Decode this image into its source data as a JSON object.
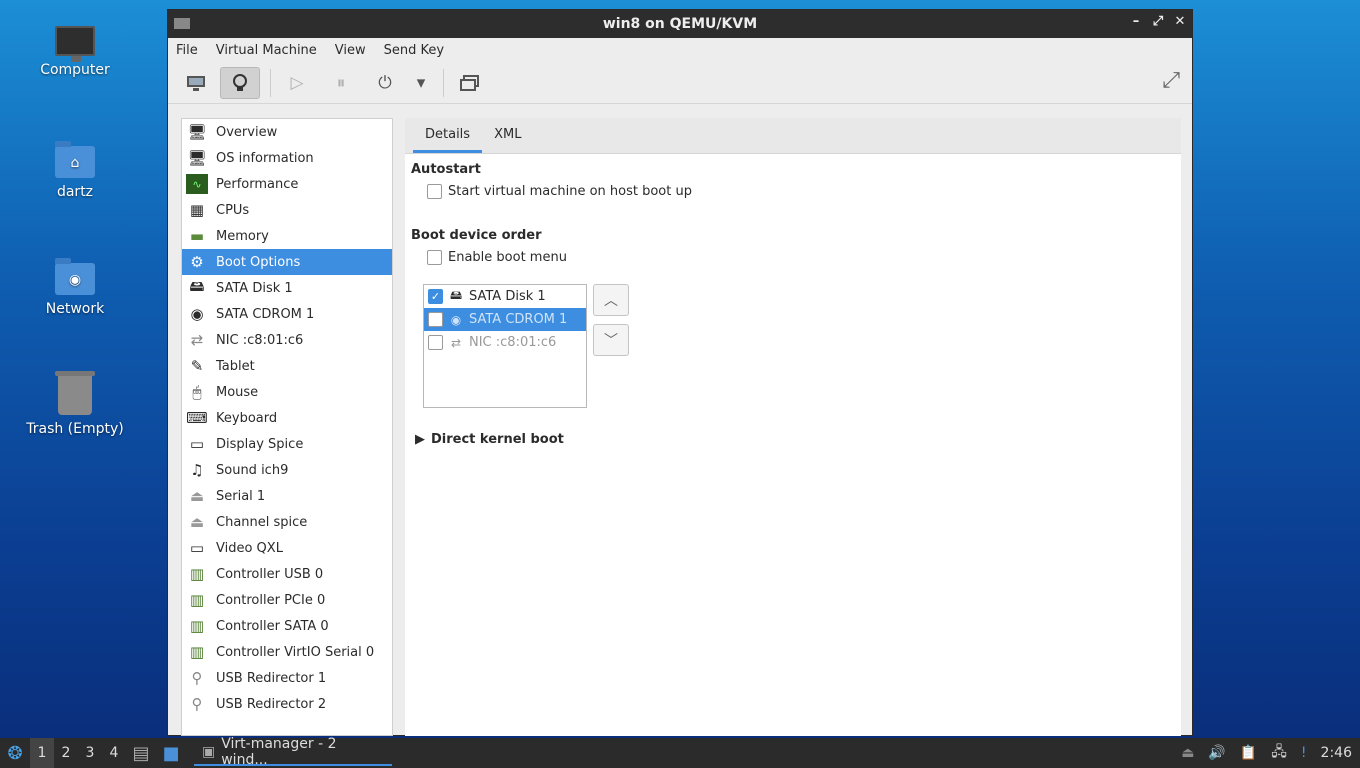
{
  "desktop": {
    "icons": [
      {
        "label": "Computer"
      },
      {
        "label": "dartz"
      },
      {
        "label": "Network"
      },
      {
        "label": "Trash (Empty)"
      }
    ]
  },
  "window": {
    "title": "win8 on QEMU/KVM",
    "controls": {
      "minimize": "–",
      "maximize": "⤢",
      "close": "✕"
    }
  },
  "menu": {
    "file": "File",
    "vm": "Virtual Machine",
    "view": "View",
    "sendkey": "Send Key"
  },
  "sidebar": {
    "items": [
      {
        "label": "Overview",
        "icon": "monitor-icon"
      },
      {
        "label": "OS information",
        "icon": "monitor-icon"
      },
      {
        "label": "Performance",
        "icon": "graph-icon"
      },
      {
        "label": "CPUs",
        "icon": "cpu-icon"
      },
      {
        "label": "Memory",
        "icon": "memory-icon"
      },
      {
        "label": "Boot Options",
        "icon": "gear-icon"
      },
      {
        "label": "SATA Disk 1",
        "icon": "disk-icon"
      },
      {
        "label": "SATA CDROM 1",
        "icon": "cdrom-icon"
      },
      {
        "label": "NIC :c8:01:c6",
        "icon": "network-icon"
      },
      {
        "label": "Tablet",
        "icon": "tablet-icon"
      },
      {
        "label": "Mouse",
        "icon": "mouse-icon"
      },
      {
        "label": "Keyboard",
        "icon": "keyboard-icon"
      },
      {
        "label": "Display Spice",
        "icon": "display-icon"
      },
      {
        "label": "Sound ich9",
        "icon": "sound-icon"
      },
      {
        "label": "Serial 1",
        "icon": "serial-icon"
      },
      {
        "label": "Channel spice",
        "icon": "channel-icon"
      },
      {
        "label": "Video QXL",
        "icon": "video-icon"
      },
      {
        "label": "Controller USB 0",
        "icon": "controller-icon"
      },
      {
        "label": "Controller PCIe 0",
        "icon": "controller-icon"
      },
      {
        "label": "Controller SATA 0",
        "icon": "controller-icon"
      },
      {
        "label": "Controller VirtIO Serial 0",
        "icon": "controller-icon"
      },
      {
        "label": "USB Redirector 1",
        "icon": "usb-icon"
      },
      {
        "label": "USB Redirector 2",
        "icon": "usb-icon"
      }
    ],
    "selected_index": 5
  },
  "details": {
    "tabs": [
      "Details",
      "XML"
    ],
    "autostart_title": "Autostart",
    "autostart_checkbox": "Start virtual machine on host boot up",
    "boot_order_title": "Boot device order",
    "boot_menu_checkbox": "Enable boot menu",
    "boot_devices": [
      {
        "label": "SATA Disk 1",
        "checked": true
      },
      {
        "label": "SATA CDROM 1",
        "checked": false
      },
      {
        "label": "NIC :c8:01:c6",
        "checked": false
      }
    ],
    "direct_kernel_boot": "Direct kernel boot"
  },
  "taskbar": {
    "workspaces": [
      "1",
      "2",
      "3",
      "4"
    ],
    "app_label": "Virt-manager - 2 wind...",
    "clock": "2:46"
  },
  "colors": {
    "accent": "#3d8ee0",
    "titlebar": "#2d2d2d"
  }
}
